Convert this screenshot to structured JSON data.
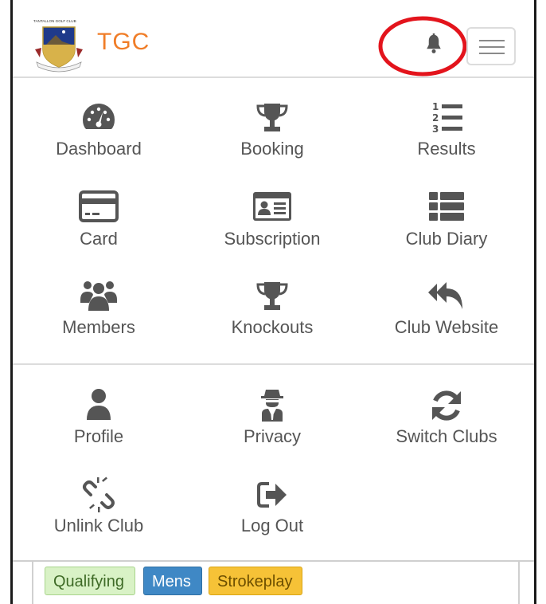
{
  "header": {
    "club_badge_text": "TANTALLON GOLF CLUB",
    "brand": "TGC",
    "notifications_label": "Notifications",
    "menu_label": "Menu"
  },
  "menu": {
    "primary": [
      {
        "label": "Dashboard",
        "icon": "dashboard-icon"
      },
      {
        "label": "Booking",
        "icon": "trophy-icon"
      },
      {
        "label": "Results",
        "icon": "numbered-list-icon"
      },
      {
        "label": "Card",
        "icon": "credit-card-icon"
      },
      {
        "label": "Subscription",
        "icon": "id-card-icon"
      },
      {
        "label": "Club Diary",
        "icon": "list-icon"
      },
      {
        "label": "Members",
        "icon": "users-icon"
      },
      {
        "label": "Knockouts",
        "icon": "trophy-icon"
      },
      {
        "label": "Club Website",
        "icon": "reply-all-icon"
      }
    ],
    "secondary": [
      {
        "label": "Profile",
        "icon": "user-icon"
      },
      {
        "label": "Privacy",
        "icon": "user-secret-icon"
      },
      {
        "label": "Switch Clubs",
        "icon": "sync-icon"
      },
      {
        "label": "Unlink Club",
        "icon": "unlink-icon"
      },
      {
        "label": "Log Out",
        "icon": "sign-out-icon"
      }
    ]
  },
  "tags": [
    {
      "label": "Qualifying",
      "color": "#d9f2c6"
    },
    {
      "label": "Mens",
      "color": "#3f88c5"
    },
    {
      "label": "Strokeplay",
      "color": "#f6c237"
    }
  ],
  "colors": {
    "brand": "#f07d28",
    "icon": "#555555",
    "annotation": "#e3141c"
  }
}
